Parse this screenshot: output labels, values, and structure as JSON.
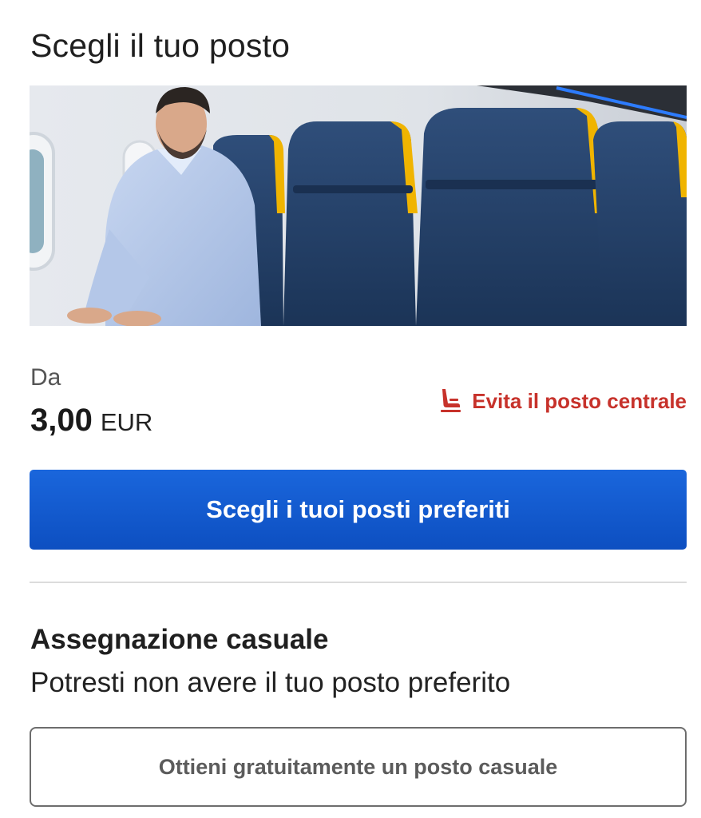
{
  "page": {
    "title": "Scegli il tuo posto"
  },
  "hero": {
    "image_description_name": "seat-photo"
  },
  "pricing": {
    "from_label": "Da",
    "price": "3,00",
    "currency": "EUR"
  },
  "avoid_middle": {
    "label": "Evita il posto centrale",
    "icon": "seat-icon",
    "color": "#c7322b"
  },
  "primary_button": {
    "label": "Scegli i tuoi posti preferiti",
    "color": "#1a66dc"
  },
  "random_assignment": {
    "title": "Assegnazione casuale",
    "description": "Potresti non avere il tuo posto preferito",
    "button_label": "Ottieni gratuitamente un posto casuale"
  }
}
